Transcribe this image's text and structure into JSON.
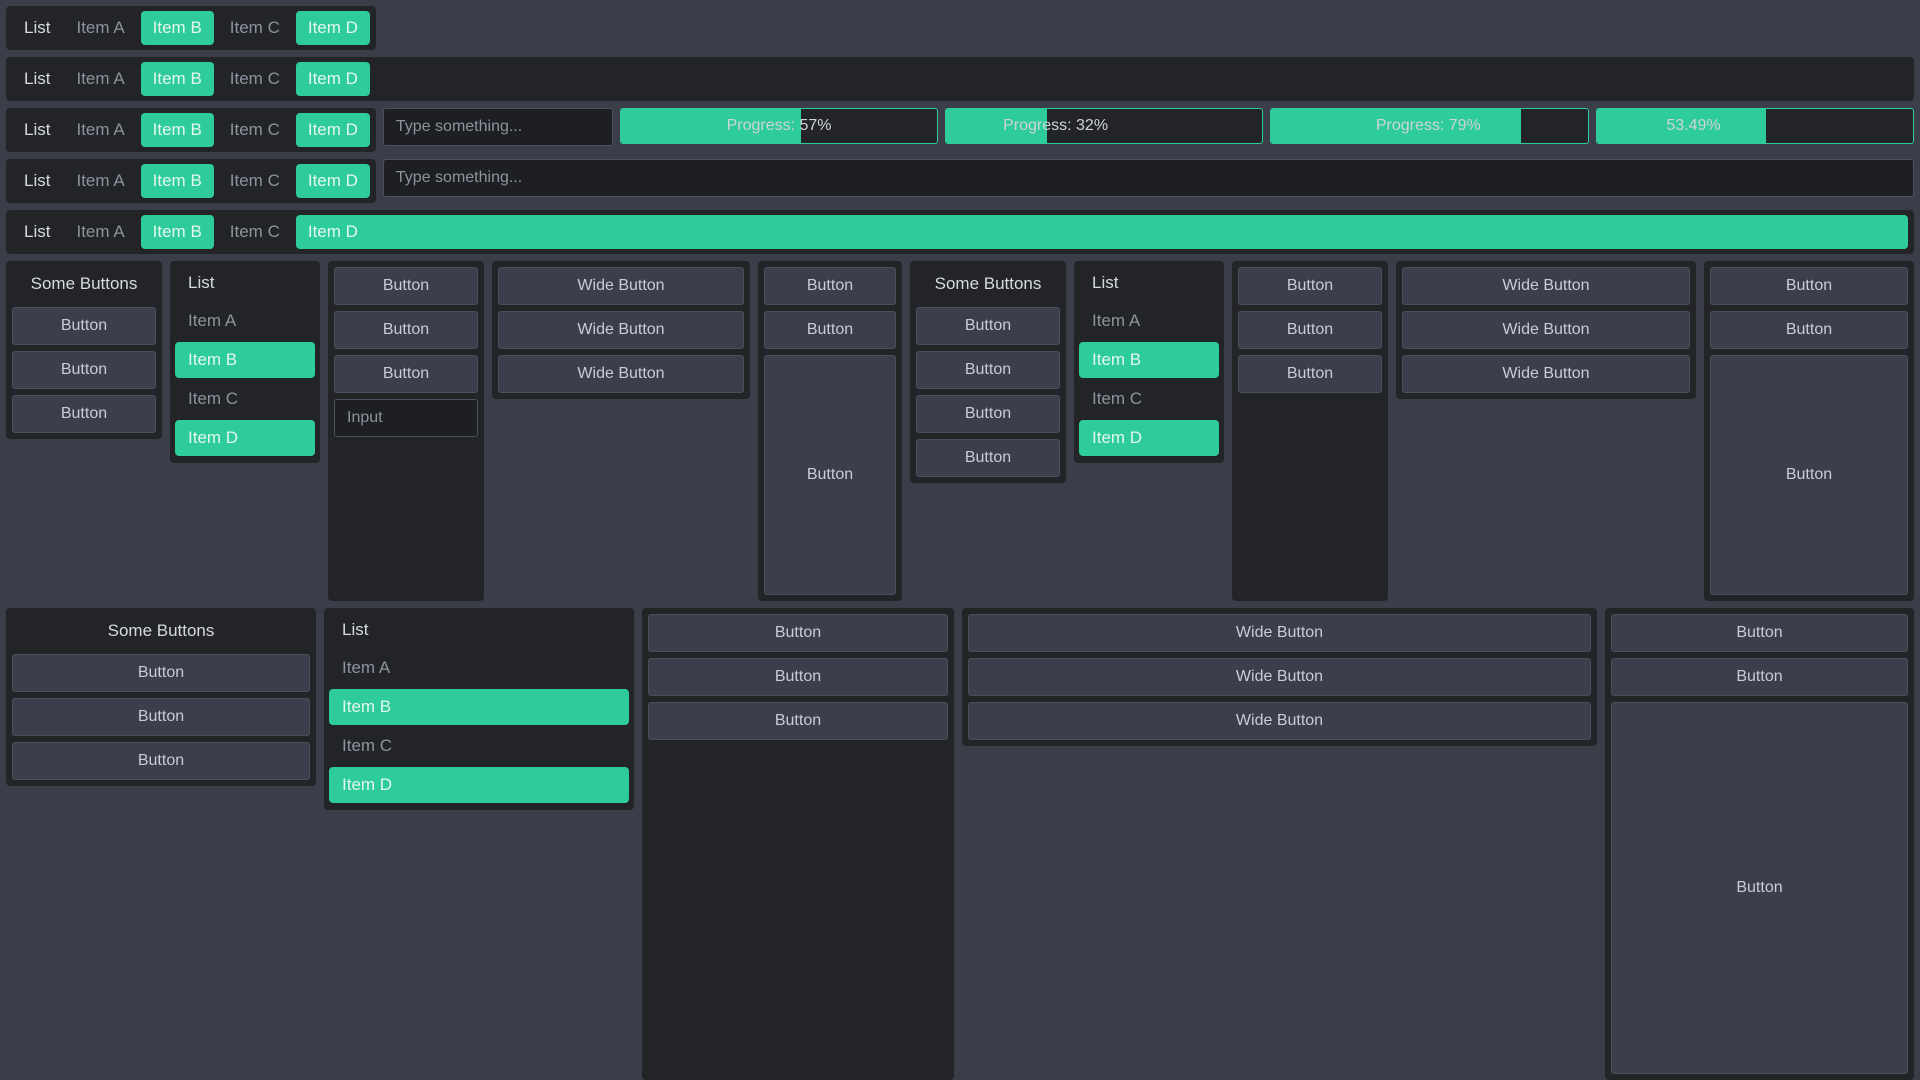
{
  "theme": {
    "page_bg": "#3b3e48",
    "panel_bg": "#232428",
    "button_bg": "#3b3f4b",
    "accent": "#2ecc9b",
    "text": "#c9ccd4",
    "text_dim": "#8d939e"
  },
  "labels": {
    "list": "List",
    "item_a": "Item A",
    "item_b": "Item B",
    "item_c": "Item C",
    "item_d": "Item D",
    "button": "Button",
    "wide_button": "Wide Button",
    "some_buttons": "Some Buttons",
    "input_placeholder": "Type something...",
    "input_label": "Input"
  },
  "bar_rows": [
    {
      "id": "row-1",
      "list": {
        "title": "List",
        "items": [
          "Item A",
          "Item B",
          "Item C",
          "Item D"
        ],
        "selected": [
          "Item B",
          "Item D"
        ]
      },
      "extras": []
    },
    {
      "id": "row-2",
      "list": {
        "title": "List",
        "items": [
          "Item A",
          "Item B",
          "Item C",
          "Item D"
        ],
        "selected": [
          "Item B",
          "Item D"
        ]
      },
      "extras": []
    },
    {
      "id": "row-3",
      "list": {
        "title": "List",
        "items": [
          "Item A",
          "Item B",
          "Item C",
          "Item D"
        ],
        "selected": [
          "Item B",
          "Item D"
        ]
      },
      "text_input": {
        "placeholder": "Type something...",
        "value": ""
      },
      "progress": [
        {
          "label": "Progress: 57%",
          "percent": 57
        },
        {
          "label": "Progress: 32%",
          "percent": 32
        },
        {
          "label": "Progress: 79%",
          "percent": 79
        },
        {
          "label": "53.49%",
          "percent": 53.49
        }
      ]
    },
    {
      "id": "row-4",
      "list": {
        "title": "List",
        "items": [
          "Item A",
          "Item B",
          "Item C",
          "Item D"
        ],
        "selected": [
          "Item B",
          "Item D"
        ]
      },
      "text_input": {
        "placeholder": "Type something...",
        "value": ""
      }
    },
    {
      "id": "row-5",
      "list": {
        "title": "List",
        "items": [
          "Item A",
          "Item B",
          "Item C",
          "Item D"
        ],
        "selected": [
          "Item B",
          "Item D"
        ],
        "stretch_last": true
      }
    }
  ],
  "middle": {
    "buttons_group_1": {
      "title": "Some Buttons",
      "buttons": [
        "Button",
        "Button",
        "Button"
      ]
    },
    "list_1": {
      "title": "List",
      "items": [
        "Item A",
        "Item B",
        "Item C",
        "Item D"
      ],
      "selected": [
        "Item B",
        "Item D"
      ]
    },
    "stack_1": {
      "buttons": [
        "Button",
        "Button",
        "Button"
      ],
      "input_label": "Input"
    },
    "wide_1": {
      "buttons": [
        "Wide Button",
        "Wide Button",
        "Wide Button"
      ]
    },
    "stack_2": {
      "buttons": [
        "Button",
        "Button"
      ],
      "tall_button": "Button"
    },
    "buttons_group_2": {
      "title": "Some Buttons",
      "buttons": [
        "Button",
        "Button",
        "Button",
        "Button"
      ]
    },
    "list_2": {
      "title": "List",
      "items": [
        "Item A",
        "Item B",
        "Item C",
        "Item D"
      ],
      "selected": [
        "Item B",
        "Item D"
      ]
    },
    "stack_3": {
      "buttons": [
        "Button",
        "Button",
        "Button"
      ]
    },
    "wide_2": {
      "buttons": [
        "Wide Button",
        "Wide Button",
        "Wide Button"
      ]
    },
    "stack_4": {
      "buttons": [
        "Button",
        "Button"
      ],
      "tall_button": "Button"
    }
  },
  "bottom": {
    "buttons_group_3": {
      "title": "Some Buttons",
      "buttons": [
        "Button",
        "Button",
        "Button"
      ]
    },
    "list_3": {
      "title": "List",
      "items": [
        "Item A",
        "Item B",
        "Item C",
        "Item D"
      ],
      "selected": [
        "Item B",
        "Item D"
      ]
    },
    "stack_5": {
      "buttons": [
        "Button",
        "Button",
        "Button"
      ]
    },
    "wide_3": {
      "buttons": [
        "Wide Button",
        "Wide Button",
        "Wide Button"
      ]
    },
    "stack_6": {
      "buttons": [
        "Button",
        "Button"
      ],
      "tall_button": "Button"
    }
  }
}
